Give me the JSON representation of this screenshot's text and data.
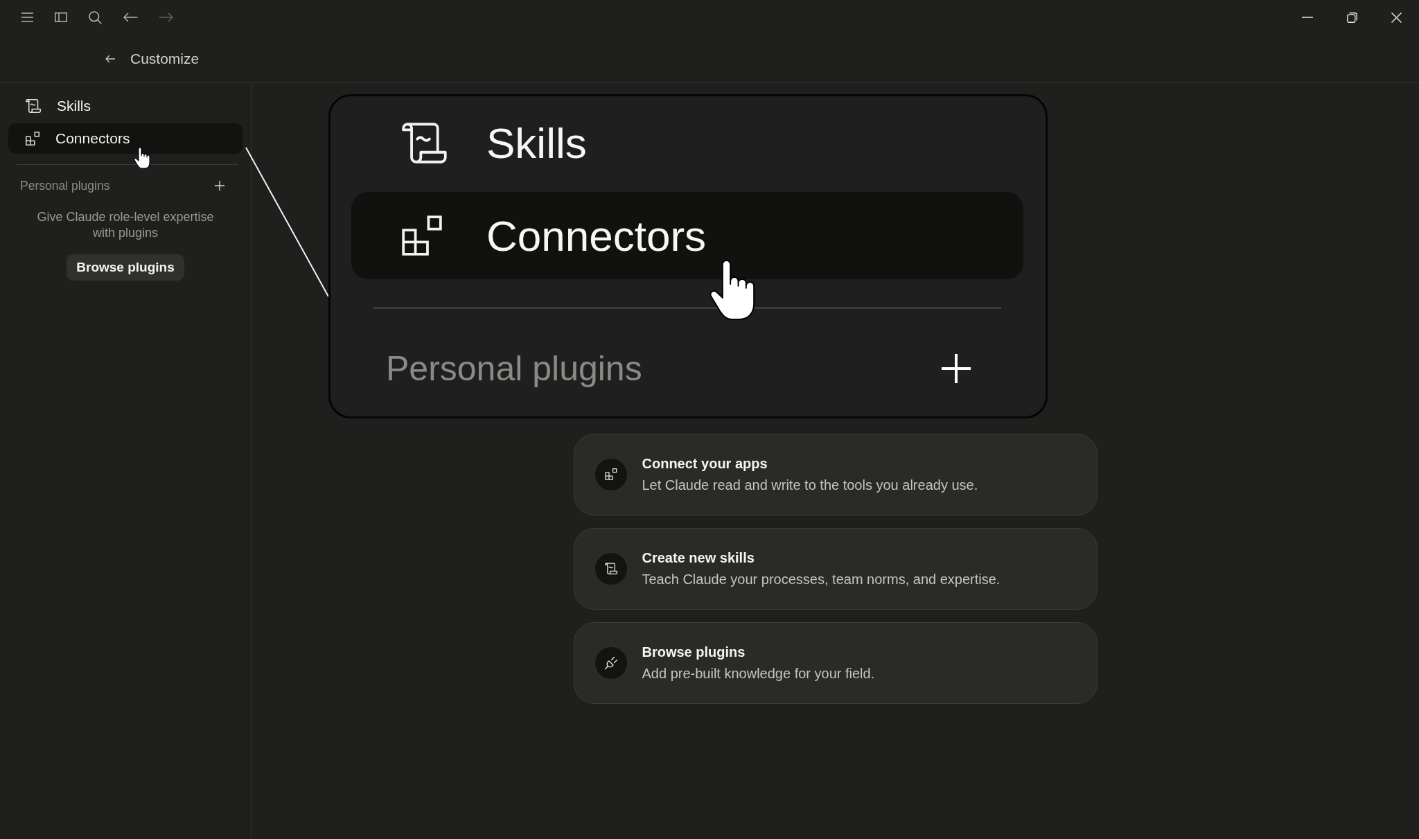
{
  "toolbar": {
    "back": {
      "disabled": false
    },
    "forward": {
      "disabled": true
    }
  },
  "header": {
    "title": "Customize"
  },
  "sidebar": {
    "items": [
      {
        "label": "Skills",
        "selected": false
      },
      {
        "label": "Connectors",
        "selected": true
      }
    ],
    "section": {
      "title": "Personal plugins"
    },
    "empty_text": "Give Claude role-level expertise with plugins",
    "button": "Browse plugins"
  },
  "zoom_callout": {
    "items": [
      {
        "label": "Skills",
        "selected": false
      },
      {
        "label": "Connectors",
        "selected": true
      }
    ],
    "section": {
      "title": "Personal plugins"
    }
  },
  "cards": [
    {
      "title": "Connect your apps",
      "description": "Let Claude read and write to the tools you already use."
    },
    {
      "title": "Create new skills",
      "description": "Teach Claude your processes, team norms, and expertise."
    },
    {
      "title": "Browse plugins",
      "description": "Add pre-built knowledge for your field."
    }
  ]
}
